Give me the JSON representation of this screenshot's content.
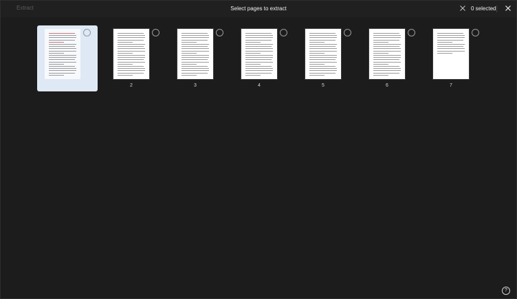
{
  "toolbar": {
    "extract_label": "Extract",
    "title": "Select pages to extract",
    "selected_count": "0 selected",
    "clear_icon": "close-icon",
    "close_icon": "close-icon"
  },
  "pages": [
    {
      "number": "",
      "hovered": true
    },
    {
      "number": "2",
      "hovered": false
    },
    {
      "number": "3",
      "hovered": false
    },
    {
      "number": "4",
      "hovered": false
    },
    {
      "number": "5",
      "hovered": false
    },
    {
      "number": "6",
      "hovered": false
    },
    {
      "number": "7",
      "hovered": false
    }
  ],
  "help": {
    "label": "?",
    "icon": "help-icon"
  },
  "colors": {
    "background": "#1c1c1c",
    "hover_card": "#dfe9f5"
  }
}
